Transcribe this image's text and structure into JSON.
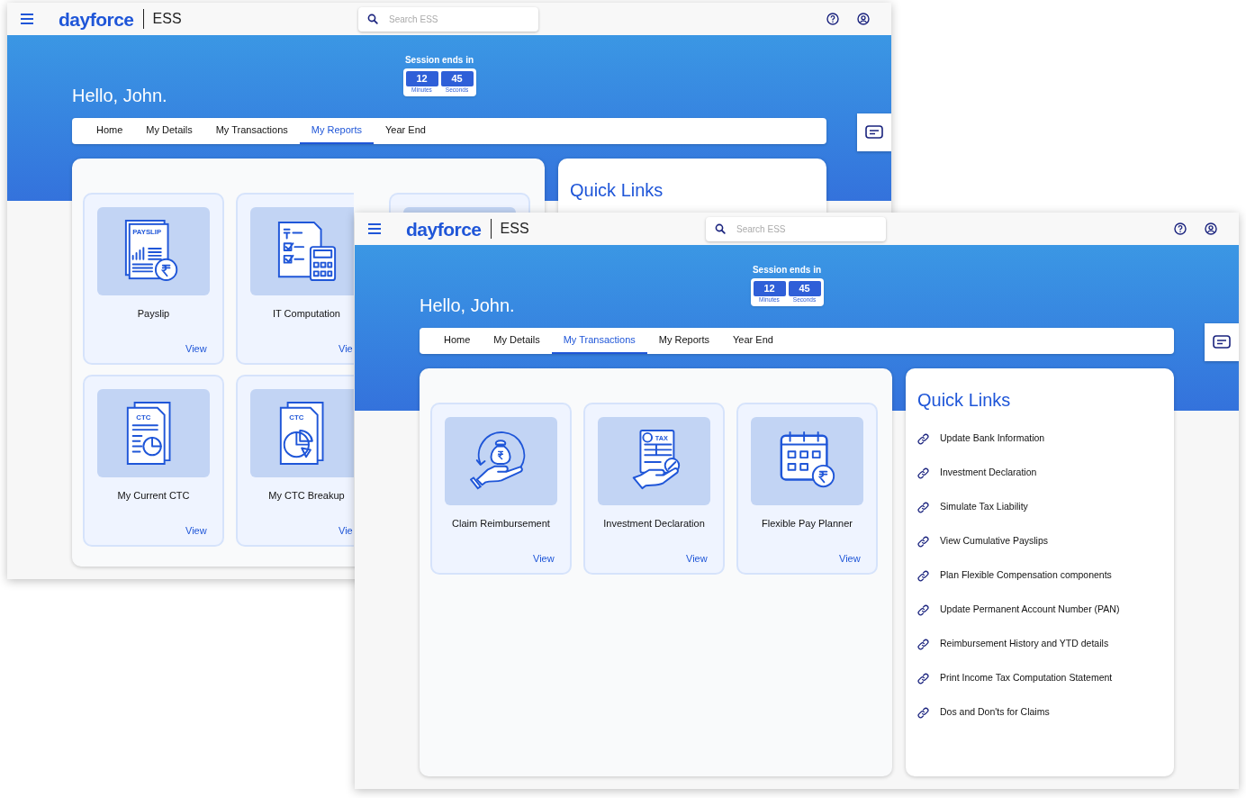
{
  "windows": [
    {
      "logo": "dayforce",
      "product": "ESS",
      "search": {
        "placeholder": "Search ESS"
      },
      "greeting": "Hello, John.",
      "session": {
        "label": "Session ends in",
        "units": [
          {
            "value": "12",
            "label": "Minutes"
          },
          {
            "value": "45",
            "label": "Seconds"
          }
        ]
      },
      "tabs": [
        {
          "label": "Home",
          "selected": false
        },
        {
          "label": "My Details",
          "selected": false
        },
        {
          "label": "My Transactions",
          "selected": false
        },
        {
          "label": "My Reports",
          "selected": true
        },
        {
          "label": "Year End",
          "selected": false
        }
      ],
      "cards": [
        {
          "kind": "payslip",
          "icon_text": "PAYSLIP",
          "title": "Payslip",
          "link": "View"
        },
        {
          "kind": "calculator",
          "title": "IT Computation",
          "link": "Vie"
        },
        {
          "kind": "blank"
        },
        {
          "kind": "ctc-report",
          "icon_text": "CTC",
          "title": "My Current CTC",
          "link": "View"
        },
        {
          "kind": "ctc-chart",
          "icon_text": "CTC",
          "title": "My CTC Breakup",
          "link": "Vie"
        }
      ],
      "quick_links": {
        "title": "Quick Links"
      }
    },
    {
      "logo": "dayforce",
      "product": "ESS",
      "search": {
        "placeholder": "Search ESS"
      },
      "greeting": "Hello, John.",
      "session": {
        "label": "Session ends in",
        "units": [
          {
            "value": "12",
            "label": "Minutes"
          },
          {
            "value": "45",
            "label": "Seconds"
          }
        ]
      },
      "tabs": [
        {
          "label": "Home",
          "selected": false
        },
        {
          "label": "My Details",
          "selected": false
        },
        {
          "label": "My Transactions",
          "selected": true
        },
        {
          "label": "My Reports",
          "selected": false
        },
        {
          "label": "Year End",
          "selected": false
        }
      ],
      "cards": [
        {
          "kind": "reimbursement",
          "title": "Claim Reimbursement",
          "link": "View"
        },
        {
          "kind": "tax",
          "icon_text": "TAX",
          "title": "Investment Declaration",
          "link": "View"
        },
        {
          "kind": "calendar",
          "title": "Flexible Pay Planner",
          "link": "View"
        }
      ],
      "quick_links": {
        "title": "Quick Links",
        "items": [
          "Update Bank Information",
          "Investment Declaration",
          "Simulate Tax Liability",
          "View Cumulative Payslips",
          "Plan Flexible Compensation components",
          "Update Permanent Account Number (PAN)",
          "Reimbursement History and YTD details",
          "Print Income Tax Computation Statement",
          "Dos and Don'ts for Claims"
        ]
      }
    }
  ]
}
